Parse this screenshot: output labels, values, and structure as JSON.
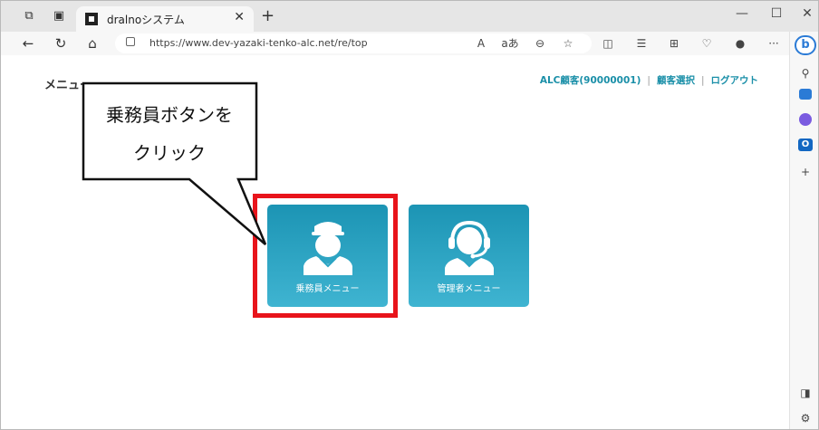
{
  "browser": {
    "tab_title": "dralnoシステム",
    "tab_close": "✕",
    "new_tab": "+",
    "url": "https://www.dev-yazaki-tenko-alc.net/re/top",
    "minimize": "—",
    "maximize": "☐",
    "close": "✕",
    "read_aloud": "A",
    "translate": "aあ",
    "more": "···"
  },
  "page": {
    "title": "メニュー",
    "customer": "ALC顧客(90000001)",
    "select_customer": "顧客選択",
    "logout": "ログアウト",
    "separator": "|"
  },
  "tiles": [
    {
      "label": "乗務員メニュー",
      "icon": "driver-icon"
    },
    {
      "label": "管理者メニュー",
      "icon": "operator-headset-icon"
    }
  ],
  "callout": {
    "line1": "乗務員ボタンを",
    "line2": "クリック",
    "highlight_color": "#e8141b"
  },
  "colors": {
    "accent": "#1a8fa8",
    "tile_top": "#1c94b4",
    "tile_bottom": "#3fb4d1"
  }
}
